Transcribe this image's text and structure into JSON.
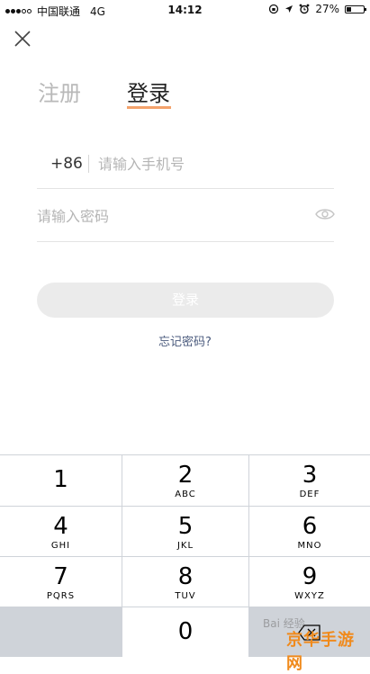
{
  "status_bar": {
    "carrier": "中国联通",
    "network": "4G",
    "time": "14:12",
    "battery": "27%",
    "battery_level": 0.27
  },
  "tabs": {
    "register": "注册",
    "login": "登录"
  },
  "phone": {
    "country_code": "+86",
    "placeholder": "请输入手机号"
  },
  "password": {
    "placeholder": "请输入密码"
  },
  "login_button": "登录",
  "forgot_password": "忘记密码?",
  "keypad": {
    "keys": [
      {
        "num": "1",
        "letters": ""
      },
      {
        "num": "2",
        "letters": "ABC"
      },
      {
        "num": "3",
        "letters": "DEF"
      },
      {
        "num": "4",
        "letters": "GHI"
      },
      {
        "num": "5",
        "letters": "JKL"
      },
      {
        "num": "6",
        "letters": "MNO"
      },
      {
        "num": "7",
        "letters": "PQRS"
      },
      {
        "num": "8",
        "letters": "TUV"
      },
      {
        "num": "9",
        "letters": "WXYZ"
      },
      {
        "num": "0",
        "letters": ""
      }
    ]
  },
  "watermark": {
    "brand": "京华手游网",
    "baidu": "Bai 经验"
  }
}
